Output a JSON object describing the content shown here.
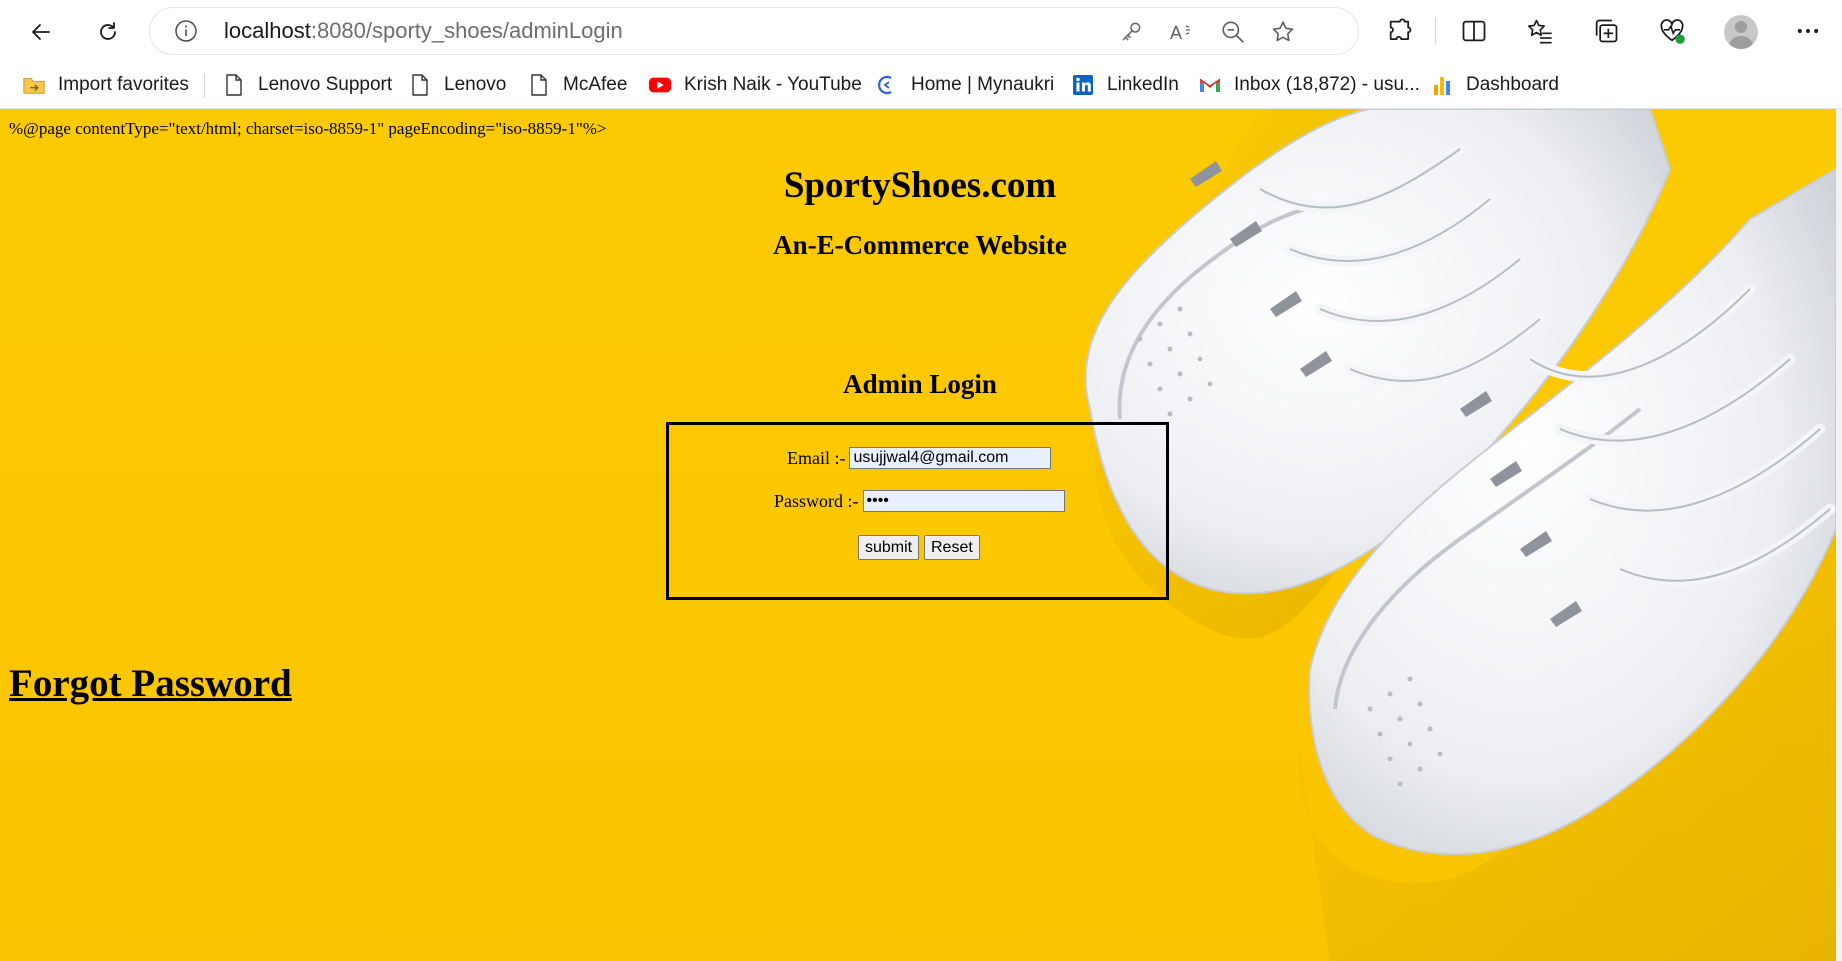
{
  "browser": {
    "url_host": "localhost",
    "url_path": ":8080/sporty_shoes/adminLogin",
    "favorites": [
      {
        "label": "Import favorites",
        "icon": "folder-import-icon"
      },
      {
        "label": "Lenovo Support",
        "icon": "page-icon"
      },
      {
        "label": "Lenovo",
        "icon": "page-icon"
      },
      {
        "label": "McAfee",
        "icon": "page-icon"
      },
      {
        "label": "Krish Naik - YouTube",
        "icon": "youtube-icon"
      },
      {
        "label": "Home | Mynaukri",
        "icon": "mynaukri-icon"
      },
      {
        "label": "LinkedIn",
        "icon": "linkedin-icon"
      },
      {
        "label": "Inbox (18,872) - usu...",
        "icon": "gmail-icon"
      },
      {
        "label": "Dashboard",
        "icon": "dashboard-icon"
      }
    ]
  },
  "page": {
    "jsp_directive_text": "%@page contentType=\"text/html; charset=iso-8859-1\" pageEncoding=\"iso-8859-1\"%>",
    "site_title": "SportyShoes.com",
    "site_subtitle": "An-E-Commerce Website",
    "login_heading": "Admin Login",
    "email_label": "Email :-",
    "email_value": "usujjwal4@gmail.com",
    "password_label": "Password :-",
    "password_value": "abcd",
    "submit_label": "submit",
    "reset_label": "Reset",
    "forgot_link": "Forgot Password"
  },
  "colors": {
    "page_background": "#fbca02",
    "text": "#000000",
    "input_autofill": "#e8f0fe"
  }
}
